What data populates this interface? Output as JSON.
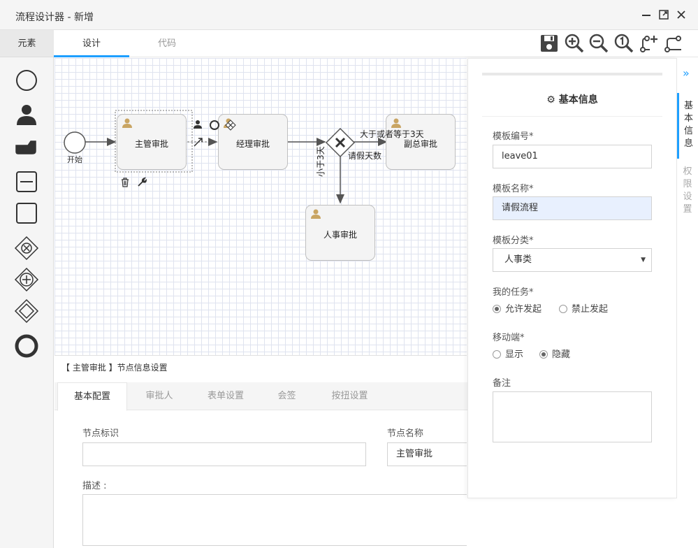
{
  "window": {
    "title": "流程设计器 - 新增"
  },
  "left_tab": "元素",
  "palette": [
    "start-event",
    "user-task",
    "manual-task",
    "subprocess",
    "task",
    "exclusive-gateway",
    "parallel-gateway",
    "inclusive-gateway",
    "end-event"
  ],
  "tabs": [
    {
      "label": "设计"
    },
    {
      "label": "代码"
    }
  ],
  "toolbar": [
    "save-icon",
    "zoom-in-icon",
    "zoom-out-icon",
    "actual-size-icon",
    "add-flow-icon",
    "flow-settings-icon"
  ],
  "diagram": {
    "start_label": "开始",
    "tasks": {
      "t1": "主管审批",
      "t2": "经理审批",
      "t3": "副总审批",
      "t4": "人事审批"
    },
    "flow_labels": {
      "greater": "大于或者等于3天",
      "cond": "请假天数",
      "less": "小于3天"
    }
  },
  "node_panel": {
    "title": "【 主管审批 】节点信息设置",
    "tabs": [
      "基本配置",
      "审批人",
      "表单设置",
      "会签",
      "按扭设置"
    ],
    "node_id_label": "节点标识",
    "node_id_value": "",
    "node_name_label": "节点名称",
    "node_name_value": "主管审批",
    "desc_label": "描述 :"
  },
  "info_drawer": {
    "title": "基本信息",
    "code_label": "模板编号*",
    "code_value": "leave01",
    "name_label": "模板名称*",
    "name_value": "请假流程",
    "category_label": "模板分类*",
    "category_value": "人事类",
    "task_label": "我的任务*",
    "task_options": [
      "允许发起",
      "禁止发起"
    ],
    "mobile_label": "移动端*",
    "mobile_options": [
      "显示",
      "隐藏"
    ],
    "remark_label": "备注"
  },
  "side_tabs": [
    "基本信息",
    "权限设置"
  ],
  "colors": {
    "accent": "#1e9fff",
    "task_icon": "#c9a563",
    "name_highlight": "#e8f0fe"
  }
}
